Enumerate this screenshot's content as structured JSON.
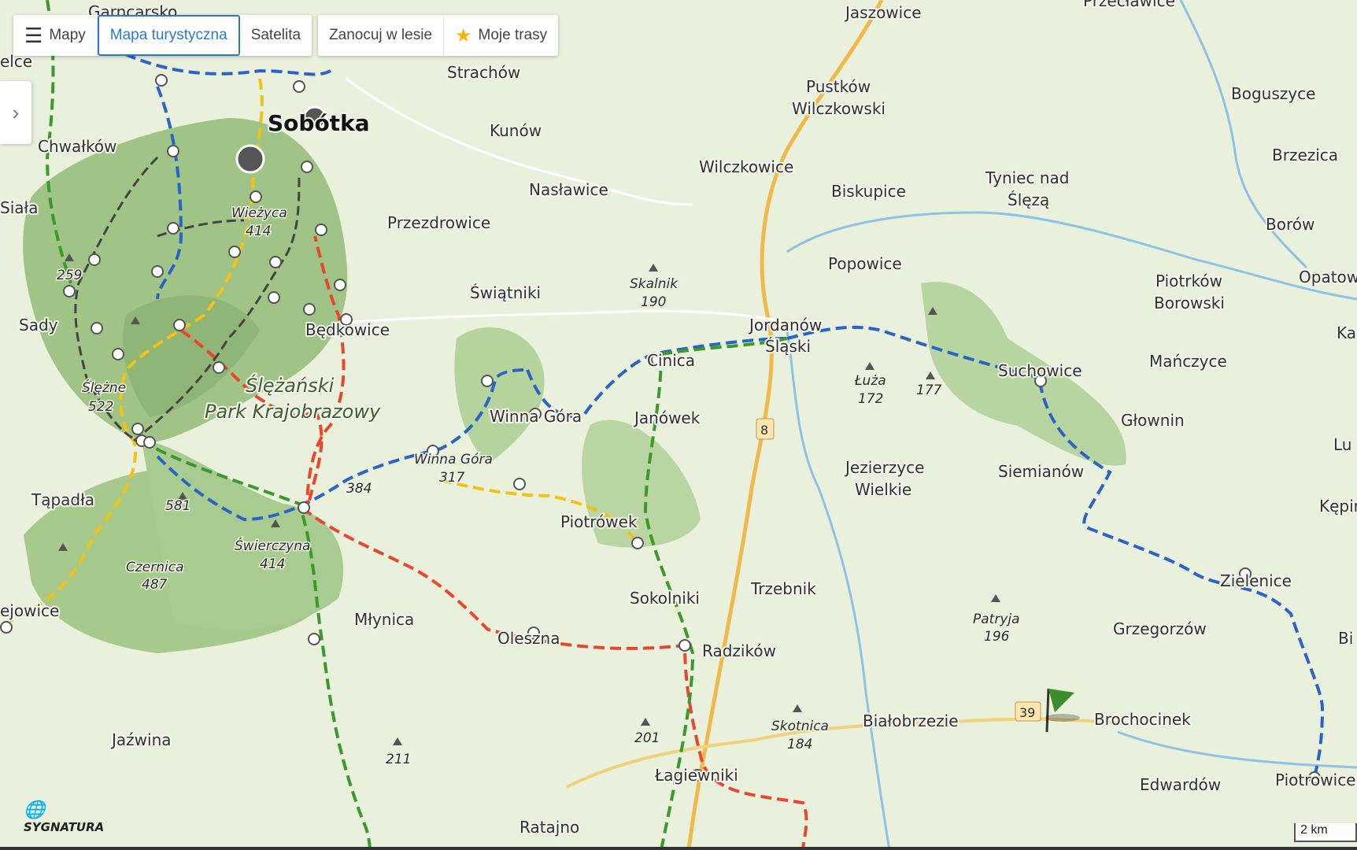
{
  "toolbar": {
    "layers_label": "Mapy",
    "tourist_label": "Mapa turystyczna",
    "satellite_label": "Satelita",
    "camp_label": "Zanocuj w lesie",
    "routes_label": "Moje trasy"
  },
  "colors": {
    "trail_blue": "#2a64c8",
    "trail_red": "#e8472e",
    "trail_green": "#3a9a2a",
    "trail_yellow": "#f2c214",
    "trail_black": "#444444",
    "road": "#f0b94a",
    "water": "#8cc3e6"
  },
  "places": {
    "sobotka": "Sobótka",
    "garncarsko": "Garncarsko",
    "elce": "elce",
    "chwalkow": "Chwałków",
    "siala": "Siała",
    "sady": "Sady",
    "tapadla": "Tąpadła",
    "ejowice": "ejowice",
    "jazwina": "Jaźwina",
    "strachow": "Strachów",
    "kunow": "Kunów",
    "naslawice": "Nasławice",
    "przezdrowice": "Przezdrowice",
    "swiatniki": "Świątniki",
    "bedkowice": "Będkowice",
    "winna_gora": "Winna Góra",
    "janowek": "Janówek",
    "cinica": "Cinica",
    "piotrowek": "Piotrówek",
    "mlynica": "Młynica",
    "olesna": "Oleszna",
    "sokolniki": "Sokolniki",
    "radzikow": "Radzików",
    "ratajno": "Ratajno",
    "lagiewniki": "Łagiewniki",
    "jaszowice": "Jaszowice",
    "pustkow": "Pustków",
    "wilczkowski": "Wilczkowski",
    "wilczkowice": "Wilczkowice",
    "biskupice": "Biskupice",
    "tyniec": "Tyniec nad",
    "sleza": "Ślęzą",
    "popowice": "Popowice",
    "jordanow": "Jordanów",
    "slaski": "Śląski",
    "suchowice": "Suchowice",
    "jezierzyce": "Jezierzyce",
    "wielkie": "Wielkie",
    "trzebnik": "Trzebnik",
    "bialobrzezie": "Białobrzezie",
    "brochocinek": "Brochocinek",
    "edwardow": "Edwardów",
    "siemianow": "Siemianów",
    "glownin": "Głownin",
    "manczyce": "Mańczyce",
    "piotrkow": "Piotrków",
    "borowski": "Borowski",
    "boguszyce": "Boguszyce",
    "brzezica": "Brzezica",
    "borow": "Borów",
    "opatow": "Opatow",
    "ka": "Ka",
    "lu": "Lu",
    "kepin": "Kępin",
    "bi": "Bi",
    "zielenice": "Zielenice",
    "grzegorzow": "Grzegorzów",
    "piotrowice": "Piotrowice",
    "przeclawice": "Przecławice",
    "park": "Ślężański",
    "park2": "Park Krajobrazowy"
  },
  "peaks": {
    "wiezyca": "Wieżyca",
    "wiezyca_h": "414",
    "p259": "259",
    "slezne": "Ślężne",
    "slezne_h": "522",
    "p581": "581",
    "czernica": "Czernica",
    "czernica_h": "487",
    "swierczyna": "Świerczyna",
    "swierczyna_h": "414",
    "p384": "384",
    "wg": "Winna Góra",
    "wg_h": "317",
    "skalnik": "Skalnik",
    "skalnik_h": "190",
    "luza": "Łuża",
    "luza_h": "172",
    "p177": "177",
    "patryja": "Patryja",
    "patryja_h": "196",
    "skotnica": "Skotnica",
    "skotnica_h": "184",
    "p201": "201",
    "p211": "211"
  },
  "roads": {
    "r8": "8",
    "r39": "39"
  },
  "scale_label": "2 km",
  "logo": "SYGNATURA"
}
